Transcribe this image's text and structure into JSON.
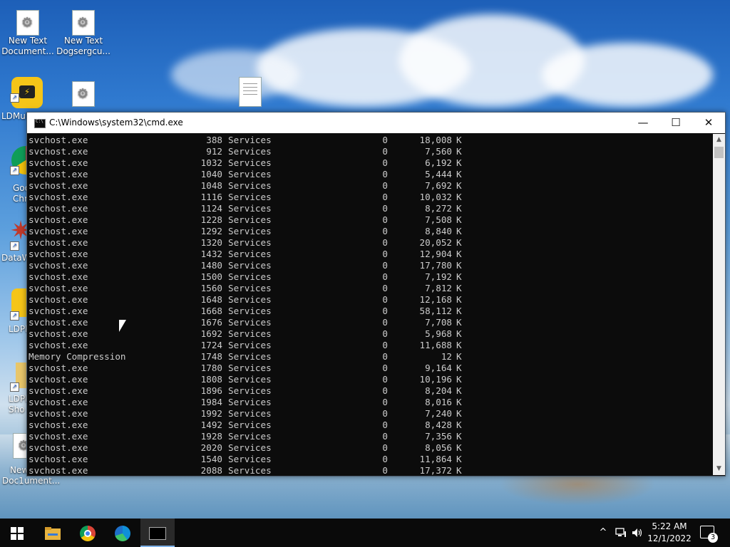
{
  "desktop": {
    "icons": [
      {
        "label_lines": [
          "New Text",
          "Document..."
        ],
        "icon": "text-document-icon"
      },
      {
        "label_lines": [
          "New Text",
          "Dogsergcu..."
        ],
        "icon": "text-document-icon"
      },
      {
        "label_lines": [
          "LDMul"
        ],
        "icon": "ldplayer-icon"
      },
      {
        "label_lines": [
          ""
        ],
        "icon": "text-document-icon"
      },
      {
        "label_lines": [
          ""
        ],
        "icon": "blank-document-icon"
      },
      {
        "label_lines": [
          "Goo",
          "Chr"
        ],
        "icon": "chrome-icon"
      },
      {
        "label_lines": [
          "DataW"
        ],
        "icon": "datawrapper-icon"
      },
      {
        "label_lines": [
          "LDPl"
        ],
        "icon": "ldplayer-icon"
      },
      {
        "label_lines": [
          "LDPl",
          "Sho"
        ],
        "icon": "folder-shortcut-icon"
      },
      {
        "label_lines": [
          "New",
          "Doc1ument..."
        ],
        "icon": "text-document-icon"
      }
    ]
  },
  "window": {
    "title": "C:\\Windows\\system32\\cmd.exe",
    "minimize_label": "—",
    "maximize_label": "☐",
    "close_label": "✕"
  },
  "console": {
    "rows": [
      {
        "name": "svchost.exe",
        "pid": "388",
        "session": "Services",
        "num": "0",
        "mem": "18,008",
        "unit": "K"
      },
      {
        "name": "svchost.exe",
        "pid": "912",
        "session": "Services",
        "num": "0",
        "mem": "7,560",
        "unit": "K"
      },
      {
        "name": "svchost.exe",
        "pid": "1032",
        "session": "Services",
        "num": "0",
        "mem": "6,192",
        "unit": "K"
      },
      {
        "name": "svchost.exe",
        "pid": "1040",
        "session": "Services",
        "num": "0",
        "mem": "5,444",
        "unit": "K"
      },
      {
        "name": "svchost.exe",
        "pid": "1048",
        "session": "Services",
        "num": "0",
        "mem": "7,692",
        "unit": "K"
      },
      {
        "name": "svchost.exe",
        "pid": "1116",
        "session": "Services",
        "num": "0",
        "mem": "10,032",
        "unit": "K"
      },
      {
        "name": "svchost.exe",
        "pid": "1124",
        "session": "Services",
        "num": "0",
        "mem": "8,272",
        "unit": "K"
      },
      {
        "name": "svchost.exe",
        "pid": "1228",
        "session": "Services",
        "num": "0",
        "mem": "7,508",
        "unit": "K"
      },
      {
        "name": "svchost.exe",
        "pid": "1292",
        "session": "Services",
        "num": "0",
        "mem": "8,840",
        "unit": "K"
      },
      {
        "name": "svchost.exe",
        "pid": "1320",
        "session": "Services",
        "num": "0",
        "mem": "20,052",
        "unit": "K"
      },
      {
        "name": "svchost.exe",
        "pid": "1432",
        "session": "Services",
        "num": "0",
        "mem": "12,904",
        "unit": "K"
      },
      {
        "name": "svchost.exe",
        "pid": "1480",
        "session": "Services",
        "num": "0",
        "mem": "17,780",
        "unit": "K"
      },
      {
        "name": "svchost.exe",
        "pid": "1500",
        "session": "Services",
        "num": "0",
        "mem": "7,192",
        "unit": "K"
      },
      {
        "name": "svchost.exe",
        "pid": "1560",
        "session": "Services",
        "num": "0",
        "mem": "7,812",
        "unit": "K"
      },
      {
        "name": "svchost.exe",
        "pid": "1648",
        "session": "Services",
        "num": "0",
        "mem": "12,168",
        "unit": "K"
      },
      {
        "name": "svchost.exe",
        "pid": "1668",
        "session": "Services",
        "num": "0",
        "mem": "58,112",
        "unit": "K"
      },
      {
        "name": "svchost.exe",
        "pid": "1676",
        "session": "Services",
        "num": "0",
        "mem": "7,708",
        "unit": "K"
      },
      {
        "name": "svchost.exe",
        "pid": "1692",
        "session": "Services",
        "num": "0",
        "mem": "5,968",
        "unit": "K"
      },
      {
        "name": "svchost.exe",
        "pid": "1724",
        "session": "Services",
        "num": "0",
        "mem": "11,688",
        "unit": "K"
      },
      {
        "name": "Memory Compression",
        "pid": "1748",
        "session": "Services",
        "num": "0",
        "mem": "12",
        "unit": "K"
      },
      {
        "name": "svchost.exe",
        "pid": "1780",
        "session": "Services",
        "num": "0",
        "mem": "9,164",
        "unit": "K"
      },
      {
        "name": "svchost.exe",
        "pid": "1808",
        "session": "Services",
        "num": "0",
        "mem": "10,196",
        "unit": "K"
      },
      {
        "name": "svchost.exe",
        "pid": "1896",
        "session": "Services",
        "num": "0",
        "mem": "8,204",
        "unit": "K"
      },
      {
        "name": "svchost.exe",
        "pid": "1984",
        "session": "Services",
        "num": "0",
        "mem": "8,016",
        "unit": "K"
      },
      {
        "name": "svchost.exe",
        "pid": "1992",
        "session": "Services",
        "num": "0",
        "mem": "7,240",
        "unit": "K"
      },
      {
        "name": "svchost.exe",
        "pid": "1492",
        "session": "Services",
        "num": "0",
        "mem": "8,428",
        "unit": "K"
      },
      {
        "name": "svchost.exe",
        "pid": "1928",
        "session": "Services",
        "num": "0",
        "mem": "7,356",
        "unit": "K"
      },
      {
        "name": "svchost.exe",
        "pid": "2020",
        "session": "Services",
        "num": "0",
        "mem": "8,056",
        "unit": "K"
      },
      {
        "name": "svchost.exe",
        "pid": "1540",
        "session": "Services",
        "num": "0",
        "mem": "11,864",
        "unit": "K"
      },
      {
        "name": "svchost.exe",
        "pid": "2088",
        "session": "Services",
        "num": "0",
        "mem": "17,372",
        "unit": "K"
      }
    ]
  },
  "taskbar": {
    "start_icon": "windows-start-icon",
    "pinned": [
      "file-explorer-icon",
      "chrome-icon",
      "edge-icon",
      "cmd-icon"
    ],
    "tray": {
      "chevron": "^",
      "network_icon": "network-icon",
      "volume_icon": "volume-icon",
      "time": "5:22 AM",
      "date": "12/1/2022",
      "notification_count": "3"
    }
  },
  "colors": {
    "console_bg": "#0c0c0c",
    "console_fg": "#cccccc",
    "taskbar_bg": "#0a0a0a"
  }
}
